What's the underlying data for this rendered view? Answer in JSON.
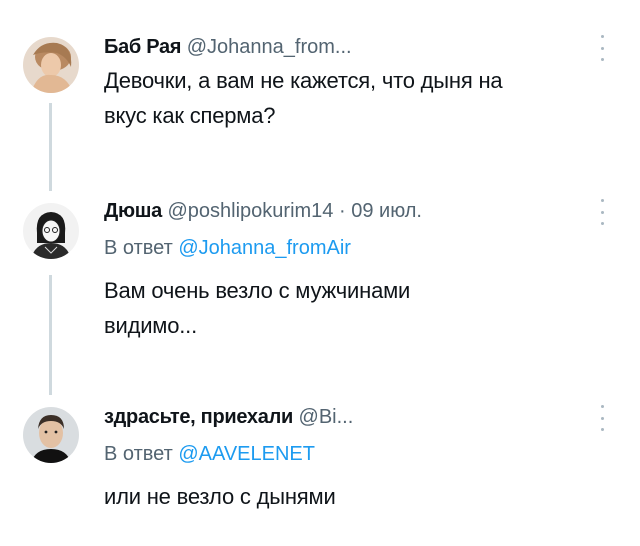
{
  "tweets": [
    {
      "name": "Баб Рая",
      "handle": "@Johanna_from...",
      "date": "",
      "reply_label": "",
      "reply_mention": "",
      "text_line1": "Девочки, а вам не кажется, что дыня на",
      "text_line2": "вкус как сперма?"
    },
    {
      "name": "Дюша",
      "handle": "@poshlipokurim14",
      "separator": "·",
      "date": "09 июл.",
      "reply_label": "В ответ",
      "reply_mention": "@Johanna_fromAir",
      "text_line1": "Вам очень везло с мужчинами",
      "text_line2": "видимо..."
    },
    {
      "name": "здрасьте, приехали",
      "handle": "@Bi...",
      "date": "",
      "reply_label": "В ответ",
      "reply_mention": "@AAVELENET",
      "text_line1": "или не везло с дынями",
      "text_line2": ""
    }
  ],
  "icons": {
    "more": "more-options-icon",
    "avatar1": "avatar-photo",
    "avatar2": "avatar-illustration",
    "avatar3": "avatar-photo"
  },
  "colors": {
    "text": "#0f1419",
    "muted": "#536471",
    "link": "#1d9bf0",
    "thread_line": "#cfd9de"
  }
}
